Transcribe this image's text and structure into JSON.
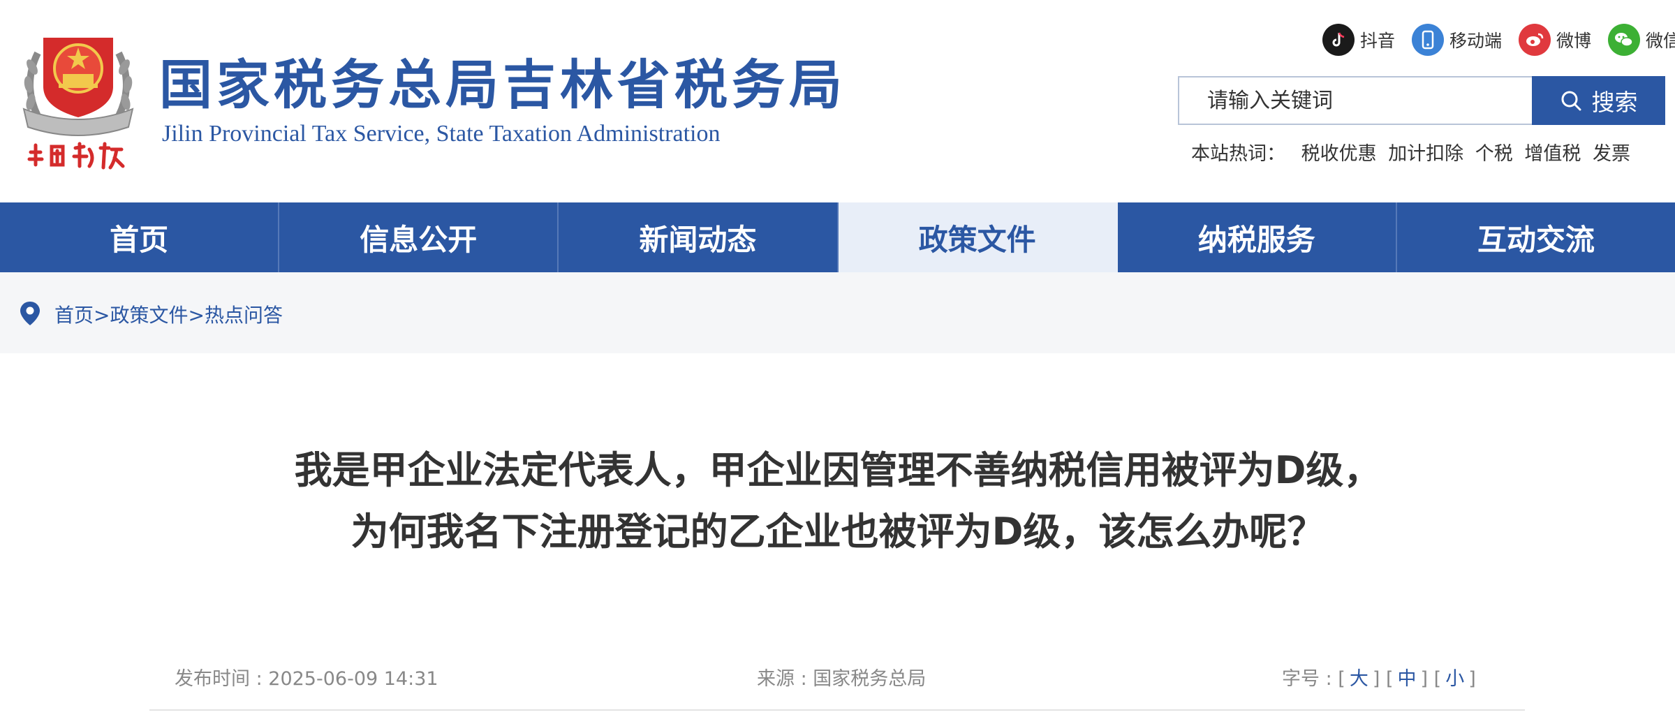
{
  "header": {
    "title": "国家税务总局吉林省税务局",
    "subtitle": "Jilin Provincial Tax Service, State Taxation Administration",
    "emblem_text": "中国税务"
  },
  "social": [
    {
      "label": "抖音",
      "icon": "tiktok-icon",
      "color": "#1a1a1a"
    },
    {
      "label": "移动端",
      "icon": "mobile-icon",
      "color": "#3b82d6"
    },
    {
      "label": "微博",
      "icon": "weibo-icon",
      "color": "#e0393e"
    },
    {
      "label": "微信",
      "icon": "wechat-icon",
      "color": "#3cb034"
    }
  ],
  "search": {
    "placeholder": "请输入关键词",
    "button_label": "搜索"
  },
  "hot": {
    "label": "本站热词：",
    "words": [
      "税收优惠",
      "加计扣除",
      "个税",
      "增值税",
      "发票"
    ]
  },
  "nav": [
    {
      "label": "首页",
      "active": false
    },
    {
      "label": "信息公开",
      "active": false
    },
    {
      "label": "新闻动态",
      "active": false
    },
    {
      "label": "政策文件",
      "active": true
    },
    {
      "label": "纳税服务",
      "active": false
    },
    {
      "label": "互动交流",
      "active": false
    }
  ],
  "breadcrumb": [
    "首页",
    "政策文件",
    "热点问答"
  ],
  "article": {
    "title_line1": "我是甲企业法定代表人，甲企业因管理不善纳税信用被评为D级，",
    "title_line2": "为何我名下注册登记的乙企业也被评为D级，该怎么办呢？",
    "publish_time": "发布时间 : 2025-06-09 14:31",
    "source": "来源 : 国家税务总局",
    "font_size_label": "字号 :",
    "font_sizes": [
      "大",
      "中",
      "小"
    ]
  },
  "colors": {
    "brand": "#2b57a3",
    "nav_active_bg": "#e8eef8",
    "breadcrumb_bg": "#f5f6f8"
  }
}
